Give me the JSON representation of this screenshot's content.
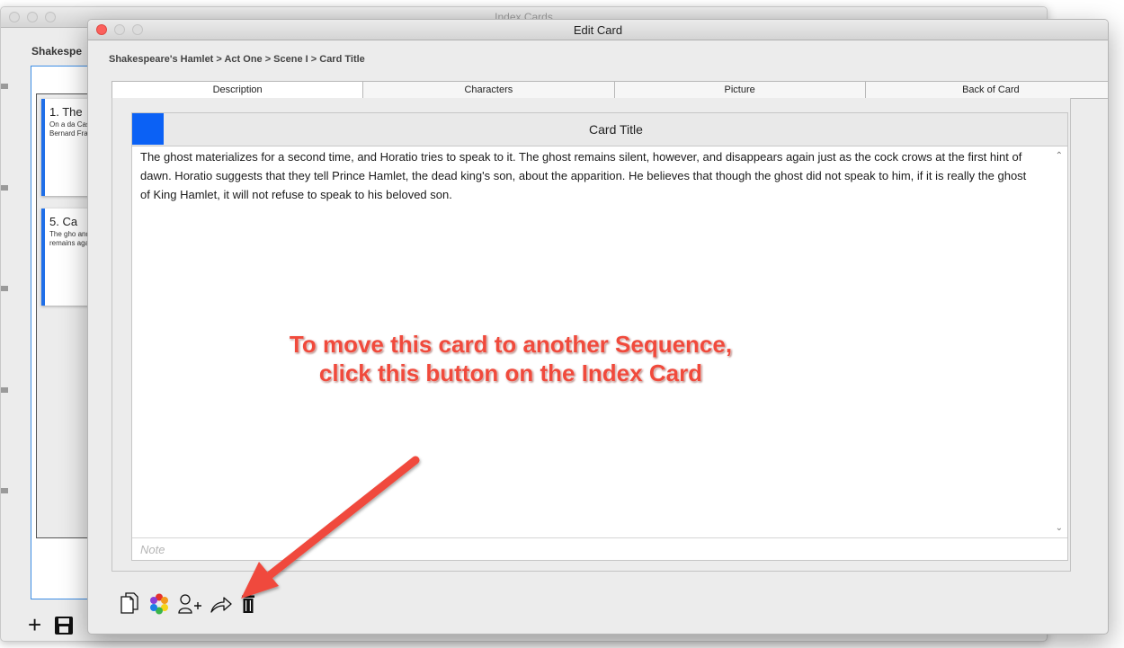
{
  "background_window": {
    "title": "Index Cards",
    "project_label": "Shakespe",
    "cards": [
      {
        "title": "1. The",
        "text": "On a da Castle i Bernard Francisc"
      },
      {
        "title": "5. Ca",
        "text": "The gho and Hor remains again ju"
      }
    ]
  },
  "edit_window": {
    "title": "Edit Card",
    "breadcrumb": "Shakespeare's Hamlet > Act One > Scene I > Card Title",
    "tabs": [
      "Description",
      "Characters",
      "Picture",
      "Back of Card"
    ],
    "active_tab": "Description",
    "card": {
      "color": "#0b61f5",
      "title": "Card Title",
      "body": "The ghost materializes for a second time, and Horatio tries to speak to it. The ghost remains silent, however, and disappears again just as the cock crows at the first hint of dawn. Horatio suggests that they tell Prince Hamlet, the dead king's son, about the apparition. He believes that though the ghost did not speak to him, if it is really the ghost of King Hamlet, it will not refuse to speak to his beloved son.",
      "note_placeholder": "Note"
    },
    "toolbar_icons": [
      "copy-icon",
      "color-wheel-icon",
      "add-character-icon",
      "move-share-icon",
      "trash-icon"
    ]
  },
  "annotation": {
    "line1": "To move this card to another Sequence,",
    "line2": "click this button on the Index Card",
    "color": "#f04a3c"
  }
}
